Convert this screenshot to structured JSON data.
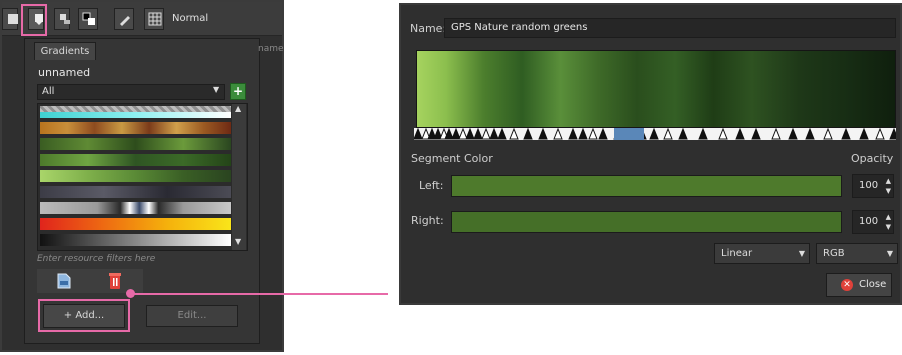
{
  "toolbar": {
    "mode_label": "Normal"
  },
  "resource_popup": {
    "tab_label": "Gradients",
    "side_text": "name",
    "resource_name": "unnamed",
    "tag_filter_value": "All",
    "add_tag_label": "+",
    "filter_placeholder": "Enter resource filters here",
    "add_button_label": "+ Add...",
    "edit_button_label": "Edit..."
  },
  "gradient_list": [
    {
      "stops": [
        "#a9a9a9",
        "#a9a9a9"
      ],
      "pattern": "checker-cyan"
    },
    {
      "stops": [
        "#b8731e",
        "#c98f3a",
        "#8e4b1f",
        "#c99a43",
        "#7b3b1a",
        "#d1a04b",
        "#9b5a22",
        "#6e2a14"
      ]
    },
    {
      "stops": [
        "#3a5d22",
        "#5f8a34",
        "#2e4d1c",
        "#6b9a3b",
        "#2a4620"
      ]
    },
    {
      "stops": [
        "#4d7a2b",
        "#6fa542",
        "#2f5523",
        "#3b6a27",
        "#244418"
      ]
    },
    {
      "stops": [
        "#a9d56a",
        "#7fb04b",
        "#5a8a36",
        "#3a5f25",
        "#2a4420"
      ]
    },
    {
      "stops": [
        "#3c3c46",
        "#5a5a66",
        "#2a2a33",
        "#4b4b55"
      ]
    },
    {
      "stops": [
        "#cfcfcf",
        "#cfcfcf"
      ],
      "pattern": "checker-metal"
    },
    {
      "stops": [
        "#e0241c",
        "#ee6a12",
        "#f5b10c",
        "#f9e51a"
      ]
    },
    {
      "stops": [
        "#111111",
        "#ffffff"
      ]
    }
  ],
  "dialog": {
    "name_label": "Name:",
    "name_value": "GPS Nature random greens",
    "segment_color_label": "Segment Color",
    "opacity_label": "Opacity",
    "left_label": "Left:",
    "right_label": "Right:",
    "left_color": "#4e7a2c",
    "right_color": "#456f28",
    "left_opacity": "100",
    "right_opacity": "100",
    "blending": "Linear",
    "color_model": "RGB",
    "close_label": "Close"
  },
  "colors": {
    "highlight": "#e76aa8"
  }
}
